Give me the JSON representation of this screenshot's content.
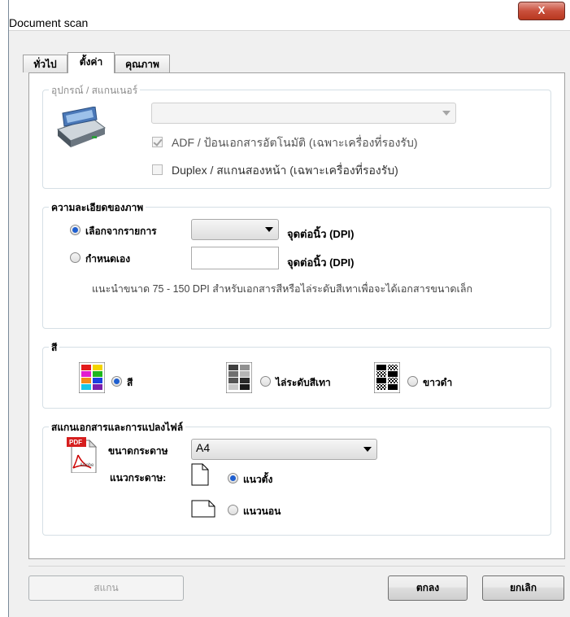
{
  "window": {
    "title": "Document scan",
    "close_label": "X"
  },
  "tabs": [
    {
      "label": "ทั่วไป"
    },
    {
      "label": "ตั้งค่า"
    },
    {
      "label": "คุณภาพ"
    }
  ],
  "device_group": {
    "legend": "อุปกรณ์ / สแกนเนอร์",
    "scanner_select_value": "",
    "adf_label": "ADF / ป้อนเอกสารอัตโนมัติ (เฉพาะเครื่องที่รองรับ)",
    "adf_checked": true,
    "duplex_label": "Duplex / สแกนสองหน้า (เฉพาะเครื่องที่รองรับ)",
    "duplex_checked": false
  },
  "resolution_group": {
    "legend": "ความละเอียดของภาพ",
    "from_list_label": "เลือกจากรายการ",
    "custom_label": "กำหนดเอง",
    "dpi_select_value": "",
    "custom_value": "",
    "unit_label": "จุดต่อนิ้ว (DPI)",
    "unit_label_2": "จุดต่อนิ้ว (DPI)",
    "hint": "แนะนำขนาด 75 - 150 DPI สำหรับเอกสารสีหรือไล่ระดับสีเทาเพื่อจะได้เอกสารขนาดเล็ก",
    "selected": "from_list"
  },
  "color_group": {
    "legend": "สี",
    "color_label": "สี",
    "gray_label": "ไล่ระดับสีเทา",
    "bw_label": "ขาวดำ",
    "selected": "color"
  },
  "pdf_group": {
    "legend": "สแกนเอกสารและการแปลงไฟล์",
    "pdf_icon_text": "PDF",
    "adobe_text": "Adobe",
    "paper_size_label": "ขนาดกระดาษ",
    "paper_size_value": "A4",
    "orientation_label": "แนวกระดาษ:",
    "portrait_label": "แนวตั้ง",
    "landscape_label": "แนวนอน",
    "selected_orientation": "portrait"
  },
  "buttons": {
    "scan": "สแกน",
    "ok": "ตกลง",
    "cancel": "ยกเลิก"
  },
  "colors": {
    "radio_selected": "#1f5fd0",
    "close_button": "#c9503c",
    "group_border": "#d5dfe5"
  }
}
